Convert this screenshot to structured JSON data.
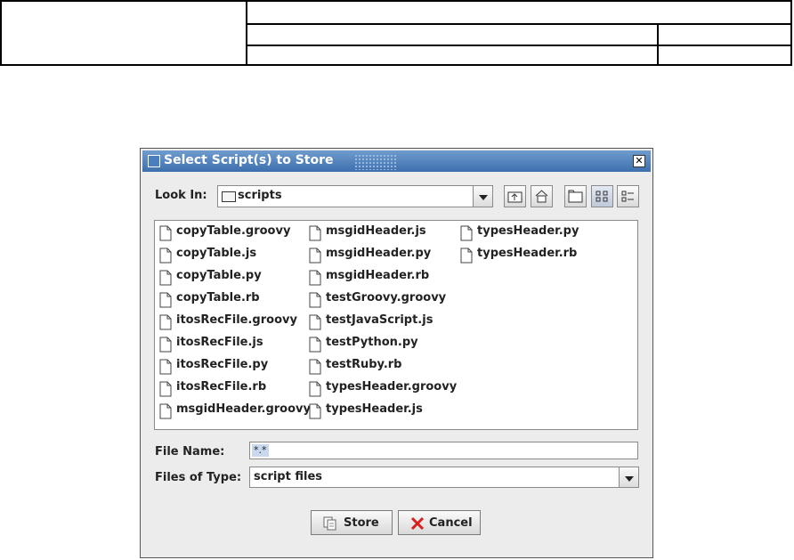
{
  "dialog": {
    "title": "Select Script(s) to Store",
    "look_in_label": "Look In:",
    "look_in_value": "scripts",
    "file_name_label": "File Name:",
    "file_name_value": "*.*",
    "files_of_type_label": "Files of Type:",
    "files_of_type_value": "script files",
    "store_label": "Store",
    "cancel_label": "Cancel"
  },
  "files": [
    "copyTable.groovy",
    "copyTable.js",
    "copyTable.py",
    "copyTable.rb",
    "itosRecFile.groovy",
    "itosRecFile.js",
    "itosRecFile.py",
    "itosRecFile.rb",
    "msgidHeader.groovy",
    "msgidHeader.js",
    "msgidHeader.py",
    "msgidHeader.rb",
    "testGroovy.groovy",
    "testJavaScript.js",
    "testPython.py",
    "testRuby.rb",
    "typesHeader.groovy",
    "typesHeader.js",
    "typesHeader.py",
    "typesHeader.rb"
  ],
  "icons": {
    "up_folder": "up-folder-icon",
    "home": "home-icon",
    "new_folder": "new-folder-icon",
    "list_view": "list-view-icon",
    "details_view": "details-view-icon",
    "file": "file-icon",
    "store": "store-icon",
    "cancel": "cancel-icon"
  },
  "colors": {
    "titlebar": "#4a7fbf",
    "dialog_bg": "#ececec",
    "cancel_red": "#d42020"
  }
}
